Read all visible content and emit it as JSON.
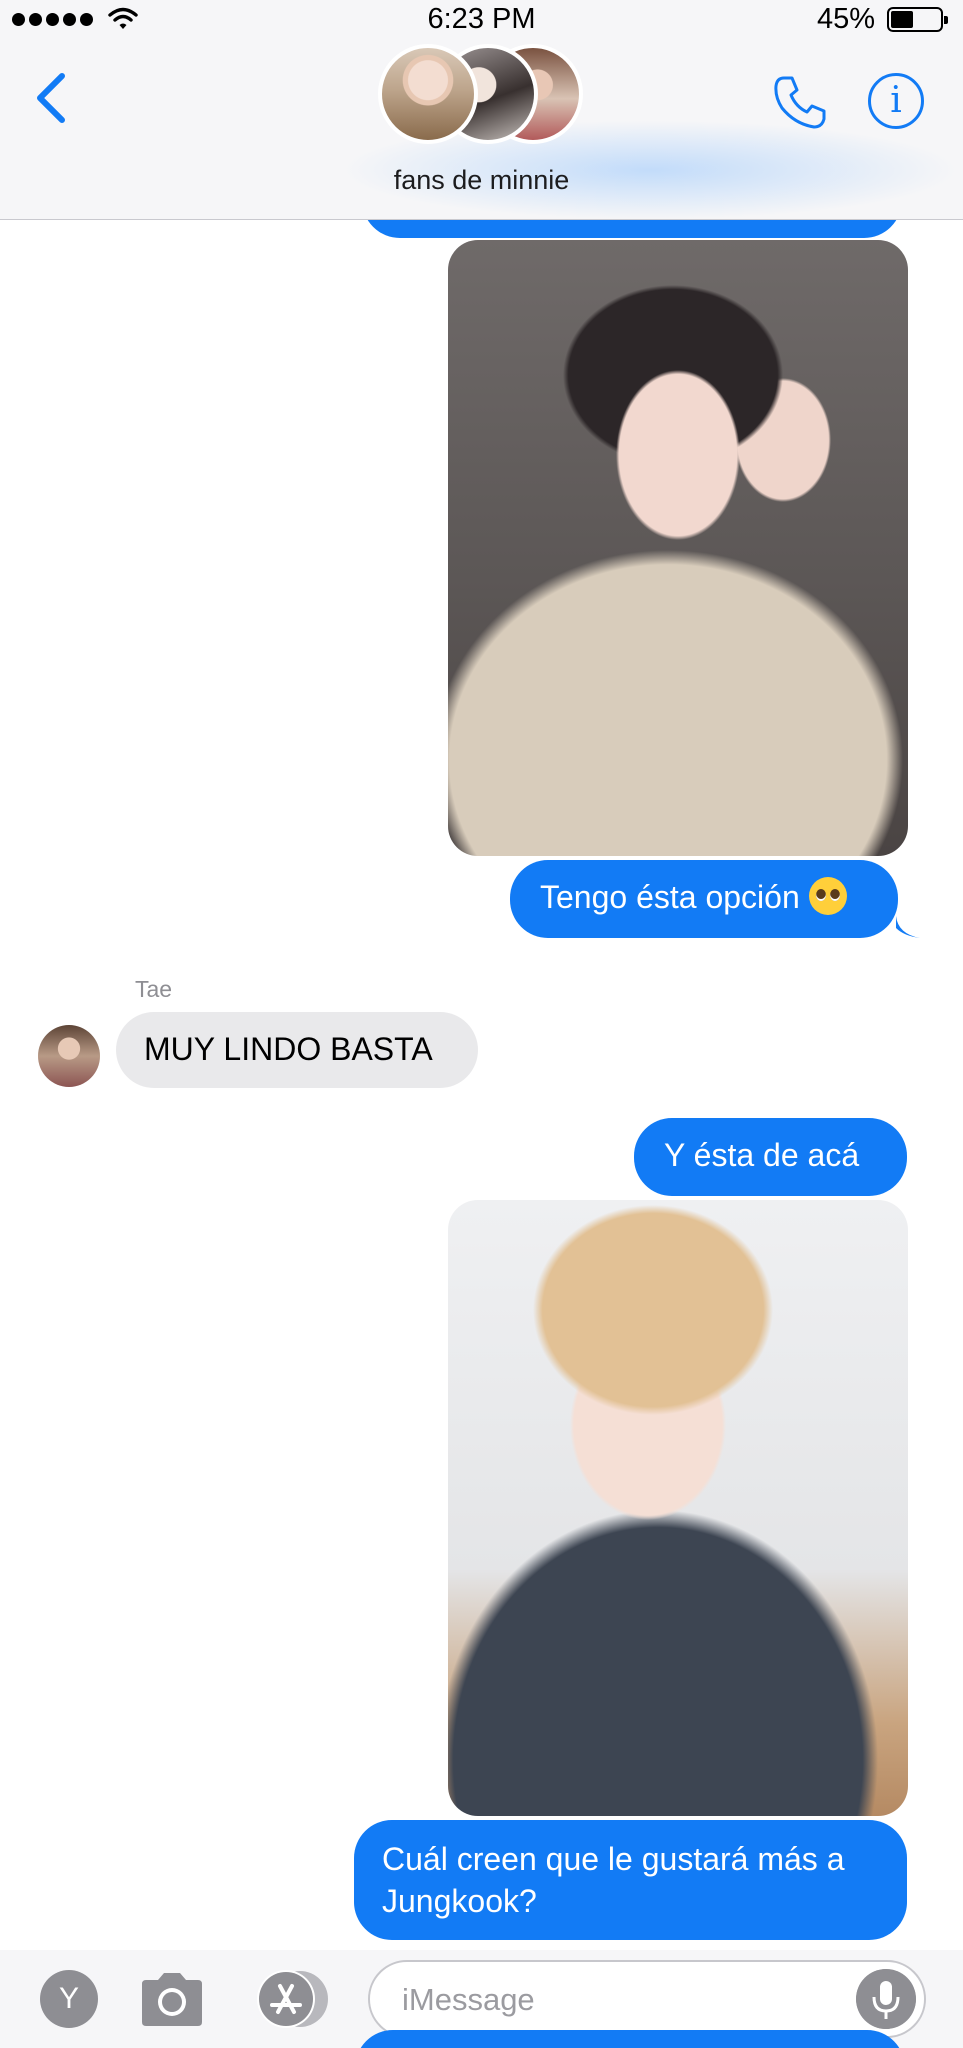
{
  "status": {
    "time": "6:23 PM",
    "battery_percent": "45%",
    "battery_level": 0.45,
    "signal_bars": 5
  },
  "header": {
    "chat_name": "fans de minnie",
    "back_icon": "chevron-left-icon",
    "call_icon": "phone-icon",
    "info_icon": "info-icon",
    "info_glyph": "i",
    "accent_color": "#127bf5"
  },
  "messages": {
    "photo1": {
      "kind": "outgoing-image"
    },
    "msg1": {
      "text": "Tengo ésta opción",
      "emoji": "pleading-face-emoji"
    },
    "sender": {
      "name": "Tae"
    },
    "msg2": {
      "text": "MUY LINDO BASTA"
    },
    "msg3": {
      "text": "Y ésta de acá"
    },
    "photo2": {
      "kind": "outgoing-image"
    },
    "msg4": {
      "line1": "Cuál creen que le gustará más a",
      "line2": "Jungkook?"
    }
  },
  "input": {
    "apps_button_label": "Y",
    "placeholder": "iMessage",
    "value": "",
    "camera_icon": "camera-icon",
    "appstore_icon": "app-store-icon",
    "mic_icon": "microphone-icon"
  },
  "colors": {
    "outgoing_bubble": "#127bf5",
    "incoming_bubble": "#e9e9eb",
    "header_bg": "#f6f6f8"
  }
}
